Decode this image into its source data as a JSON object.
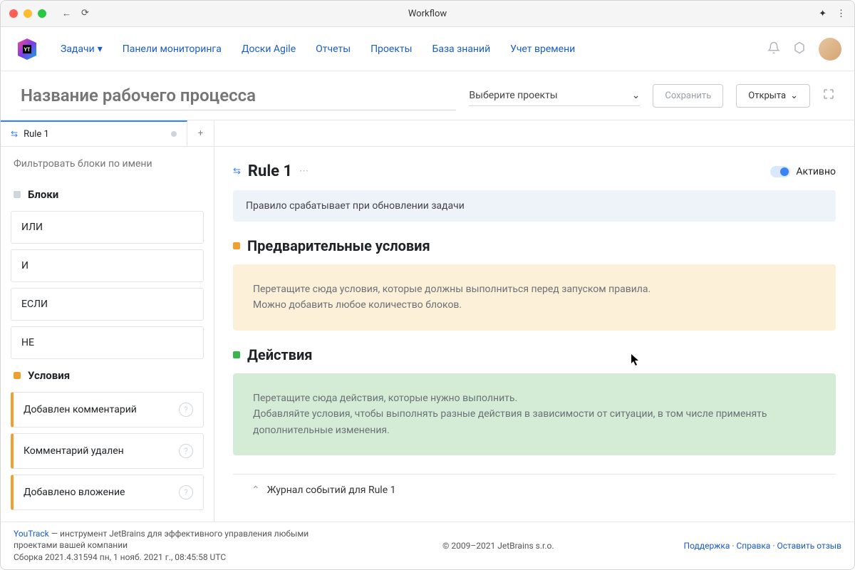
{
  "window": {
    "title": "Workflow"
  },
  "nav": {
    "items": [
      "Задачи",
      "Панели мониторинга",
      "Доски Agile",
      "Отчеты",
      "Проекты",
      "База знаний",
      "Учет времени"
    ]
  },
  "toolbar": {
    "title_placeholder": "Название рабочего процесса",
    "project_placeholder": "Выберите проекты",
    "save_label": "Сохранить",
    "open_label": "Открыта"
  },
  "tabs": {
    "active": "Rule 1"
  },
  "sidebar": {
    "filter_placeholder": "Фильтровать блоки по имени",
    "groups": {
      "blocks_title": "Блоки",
      "blocks": [
        "ИЛИ",
        "И",
        "ЕСЛИ",
        "НЕ"
      ],
      "conditions_title": "Условия",
      "conditions": [
        "Добавлен комментарий",
        "Комментарий удален",
        "Добавлено вложение"
      ]
    }
  },
  "main": {
    "rule_title": "Rule 1",
    "active_label": "Активно",
    "trigger_text": "Правило срабатывает при обновлении задачи",
    "preconditions_title": "Предварительные условия",
    "preconditions_hint1": "Перетащите сюда условия, которые должны выполниться перед запуском правила.",
    "preconditions_hint2": "Можно добавить любое количество блоков.",
    "actions_title": "Действия",
    "actions_hint1": "Перетащите сюда действия, которые нужно выполнить.",
    "actions_hint2": "Добавляйте условия, чтобы выполнять разные действия в зависимости от ситуации, в том числе применять дополнительные изменения.",
    "eventlog_label": "Журнал событий для Rule 1"
  },
  "footer": {
    "product": "YouTrack",
    "tagline": " — инструмент JetBrains для эффективного управления любыми проектами вашей компании",
    "build": "Сборка 2021.4.31594 пн, 1 нояб. 2021 г., 08:45:58 UTC",
    "copyright": "© 2009–2021 JetBrains s.r.o.",
    "links": [
      "Поддержка",
      "Справка",
      "Оставить отзыв"
    ]
  }
}
